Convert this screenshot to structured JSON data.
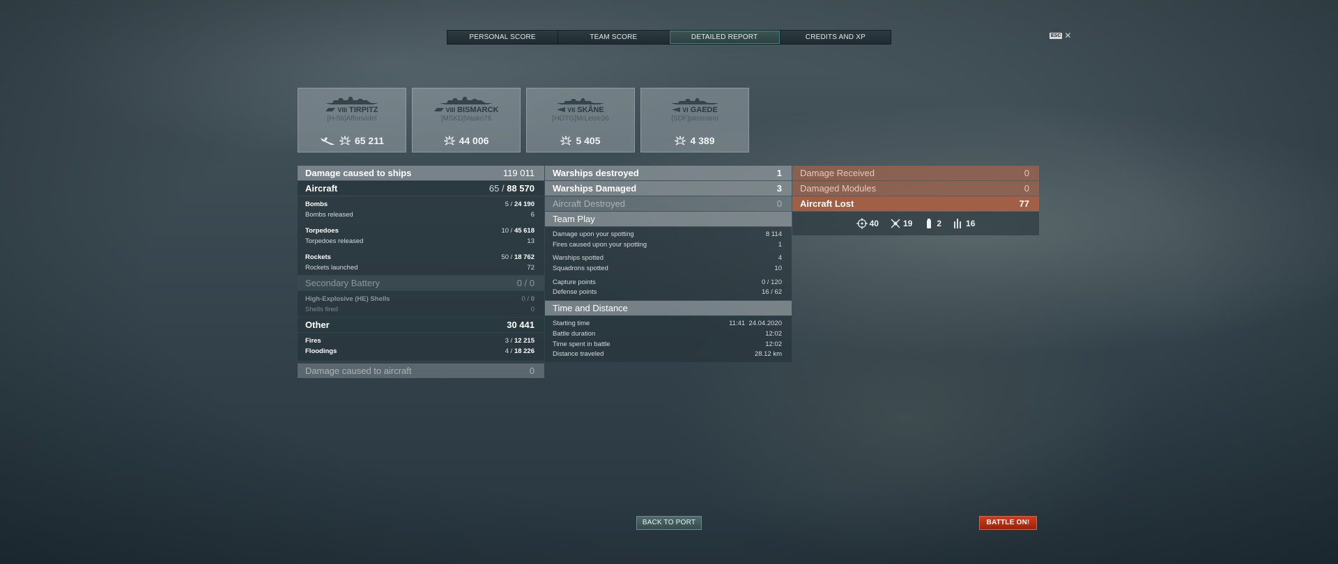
{
  "tabs": [
    {
      "label": "PERSONAL SCORE",
      "active": false
    },
    {
      "label": "TEAM SCORE",
      "active": false
    },
    {
      "label": "DETAILED REPORT",
      "active": true
    },
    {
      "label": "CREDITS AND XP",
      "active": false
    }
  ],
  "esc": {
    "key": "ESC",
    "close": "✕"
  },
  "ships": [
    {
      "tier": "VIII",
      "name": "TIRPITZ",
      "player": "[H-56]Affonvidel",
      "damage": "65 211",
      "class_icon": "battleship-icon",
      "has_plane_icon": true
    },
    {
      "tier": "VIII",
      "name": "BISMARCK",
      "player": "[MSKD]Vasko76",
      "damage": "44 006",
      "class_icon": "battleship-icon",
      "has_plane_icon": false
    },
    {
      "tier": "VII",
      "name": "SKÅNE",
      "player": "[HOTG]MrLeise36",
      "damage": "5 405",
      "class_icon": "cruiser-icon",
      "has_plane_icon": false
    },
    {
      "tier": "VI",
      "name": "GAEDE",
      "player": "[SDF]piromano",
      "damage": "4 389",
      "class_icon": "cruiser-icon",
      "has_plane_icon": false
    }
  ],
  "col1": {
    "damage_ships": {
      "label": "Damage caused to ships",
      "value": "119 011"
    },
    "aircraft": {
      "label": "Aircraft",
      "hits": "65 /",
      "value": "88 570"
    },
    "bombs": {
      "label": "Bombs",
      "hits": "5 /",
      "value": "24 190"
    },
    "bombs_released": {
      "label": "Bombs released",
      "value": "6"
    },
    "torpedoes": {
      "label": "Torpedoes",
      "hits": "10 /",
      "value": "45 618"
    },
    "torpedoes_released": {
      "label": "Torpedoes released",
      "value": "13"
    },
    "rockets": {
      "label": "Rockets",
      "hits": "50 /",
      "value": "18 762"
    },
    "rockets_launched": {
      "label": "Rockets launched",
      "value": "72"
    },
    "secondary": {
      "label": "Secondary Battery",
      "value": "0 / 0"
    },
    "he_shells": {
      "label": "High-Explosive (HE) Shells",
      "hits": "0 /",
      "value": "0"
    },
    "shells_fired": {
      "label": "Shells fired",
      "value": "0"
    },
    "other": {
      "label": "Other",
      "value": "30 441"
    },
    "fires": {
      "label": "Fires",
      "hits": "3 /",
      "value": "12 215"
    },
    "floodings": {
      "label": "Floodings",
      "hits": "4 /",
      "value": "18 226"
    },
    "damage_aircraft": {
      "label": "Damage caused to aircraft",
      "value": "0"
    }
  },
  "col2": {
    "warships_destroyed": {
      "label": "Warships destroyed",
      "value": "1"
    },
    "warships_damaged": {
      "label": "Warships Damaged",
      "value": "3"
    },
    "aircraft_destroyed": {
      "label": "Aircraft Destroyed",
      "value": "0"
    },
    "team_play": {
      "label": "Team Play"
    },
    "damage_spotting": {
      "label": "Damage upon your spotting",
      "value": "8 114"
    },
    "fires_spotting": {
      "label": "Fires caused upon your spotting",
      "value": "1"
    },
    "warships_spotted": {
      "label": "Warships spotted",
      "value": "4"
    },
    "squadrons_spotted": {
      "label": "Squadrons spotted",
      "value": "10"
    },
    "capture_points": {
      "label": "Capture points",
      "value": "0 / 120"
    },
    "defense_points": {
      "label": "Defense points",
      "value": "16 / 62"
    },
    "time_distance": {
      "label": "Time and Distance"
    },
    "starting_time": {
      "label": "Starting time",
      "value": "11:41  24.04.2020"
    },
    "battle_duration": {
      "label": "Battle duration",
      "value": "12:02"
    },
    "time_spent": {
      "label": "Time spent in battle",
      "value": "12:02"
    },
    "distance": {
      "label": "Distance traveled",
      "value": "28.12 km"
    }
  },
  "col3": {
    "damage_received": {
      "label": "Damage Received",
      "value": "0"
    },
    "damaged_modules": {
      "label": "Damaged Modules",
      "value": "0"
    },
    "aircraft_lost": {
      "label": "Aircraft Lost",
      "value": "77"
    },
    "lost_breakdown": [
      {
        "icon": "crosshair-icon",
        "value": "40"
      },
      {
        "icon": "fighter-shot-icon",
        "value": "19"
      },
      {
        "icon": "canister-icon",
        "value": "2"
      },
      {
        "icon": "flak-icon",
        "value": "16"
      }
    ]
  },
  "buttons": {
    "back": "BACK TO PORT",
    "battle": "BATTLE ON!"
  },
  "colors": {
    "accent_orange": "#af5f41",
    "battle_red": "#c2300f",
    "tab_active": "#3e8c85"
  }
}
